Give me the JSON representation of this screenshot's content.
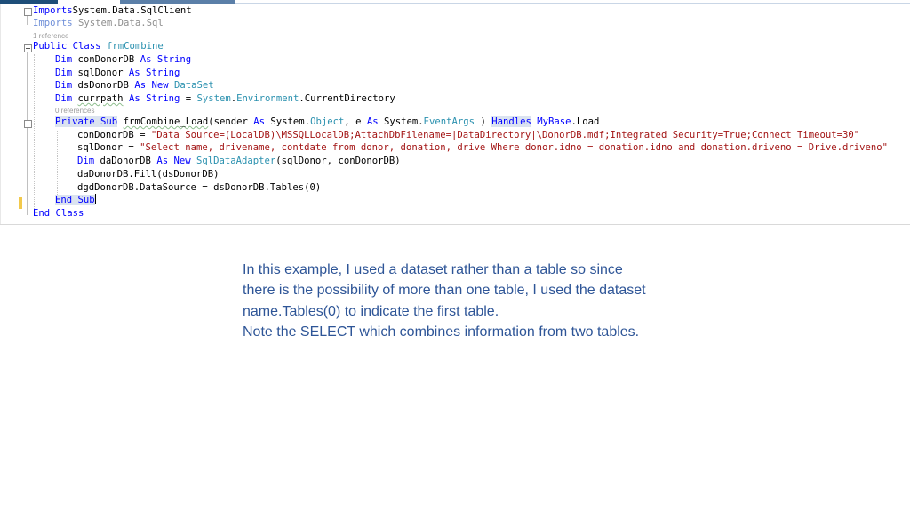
{
  "editor": {
    "lines": [
      {
        "t": "code",
        "parts": [
          [
            "kw",
            "Imports"
          ],
          [
            "",
            "System.Data.SqlClient"
          ]
        ]
      },
      {
        "t": "code",
        "parts": [
          [
            "dimkw",
            "Imports"
          ],
          [
            "dim",
            " System.Data.Sql"
          ]
        ]
      },
      {
        "t": "ref",
        "text": "1 reference"
      },
      {
        "t": "code",
        "parts": [
          [
            "kw",
            "Public Class"
          ],
          [
            "",
            " "
          ],
          [
            "ty",
            "frmCombine"
          ]
        ]
      },
      {
        "t": "code",
        "parts": [
          [
            "kw",
            "Dim"
          ],
          [
            "",
            " conDonorDB "
          ],
          [
            "kw",
            "As String"
          ]
        ]
      },
      {
        "t": "code",
        "parts": [
          [
            "kw",
            "Dim"
          ],
          [
            "",
            " sqlDonor "
          ],
          [
            "kw",
            "As String"
          ]
        ]
      },
      {
        "t": "code",
        "parts": [
          [
            "kw",
            "Dim"
          ],
          [
            "",
            " dsDonorDB "
          ],
          [
            "kw",
            "As New"
          ],
          [
            "",
            " "
          ],
          [
            "ty",
            "DataSet"
          ]
        ]
      },
      {
        "t": "code",
        "parts": [
          [
            "kw",
            "Dim"
          ],
          [
            "",
            " "
          ],
          [
            "sq",
            "currpath"
          ],
          [
            "",
            " "
          ],
          [
            "kw",
            "As String"
          ],
          [
            "",
            " = "
          ],
          [
            "ty",
            "System"
          ],
          [
            "",
            "."
          ],
          [
            "ty",
            "Environment"
          ],
          [
            "",
            ".CurrentDirectory"
          ]
        ]
      },
      {
        "t": "ref",
        "text": "0 references"
      },
      {
        "t": "code",
        "parts": [
          [
            "kw hl",
            "Private Sub"
          ],
          [
            "",
            " "
          ],
          [
            "sq",
            "frmCombine_Load"
          ],
          [
            "",
            "(sender "
          ],
          [
            "kw",
            "As"
          ],
          [
            "",
            " System."
          ],
          [
            "ty",
            "Object"
          ],
          [
            "",
            ", e "
          ],
          [
            "kw",
            "As"
          ],
          [
            "",
            " System."
          ],
          [
            "ty",
            "EventArgs"
          ],
          [
            "",
            " ) "
          ],
          [
            "kw hl",
            "Handles"
          ],
          [
            "",
            " "
          ],
          [
            "kw",
            "MyBase"
          ],
          [
            "",
            ".Load"
          ]
        ]
      },
      {
        "t": "code",
        "parts": [
          [
            "",
            "conDonorDB = "
          ],
          [
            "st",
            "\"Data Source=(LocalDB)\\MSSQLLocalDB;AttachDbFilename=|DataDirectory|\\DonorDB.mdf;Integrated Security=True;Connect Timeout=30\""
          ]
        ]
      },
      {
        "t": "code",
        "parts": [
          [
            "",
            "sqlDonor = "
          ],
          [
            "st",
            "\"Select name, drivename, contdate from donor, donation, drive Where donor.idno = donation.idno and donation.driveno = Drive.driveno\""
          ]
        ]
      },
      {
        "t": "code",
        "parts": [
          [
            "kw",
            "Dim"
          ],
          [
            "",
            " daDonorDB "
          ],
          [
            "kw",
            "As New"
          ],
          [
            "",
            " "
          ],
          [
            "ty",
            "SqlDataAdapter"
          ],
          [
            "",
            "(sqlDonor, conDonorDB)"
          ]
        ]
      },
      {
        "t": "code",
        "parts": [
          [
            "",
            "daDonorDB.Fill(dsDonorDB)"
          ]
        ]
      },
      {
        "t": "code",
        "parts": [
          [
            "",
            "dgdDonorDB.DataSource = dsDonorDB.Tables(0)"
          ]
        ]
      },
      {
        "t": "code",
        "parts": [
          [
            "kw hl",
            "End Sub"
          ]
        ]
      },
      {
        "t": "code",
        "parts": [
          [
            "kw",
            "End Class"
          ]
        ]
      }
    ]
  },
  "note": {
    "paragraph1": "In this example, I used a dataset rather than a table so since there is the possibility of more than one table, I used the dataset name.Tables(0) to indicate the first table.",
    "paragraph2": "Note the SELECT which combines information from two tables."
  },
  "colors": {
    "keyword": "#0000ff",
    "type": "#2b91af",
    "string": "#a31515",
    "note_text": "#2e5597",
    "change_marker": "#f2c94c"
  },
  "icons": [
    "fold-collapse-icon"
  ]
}
